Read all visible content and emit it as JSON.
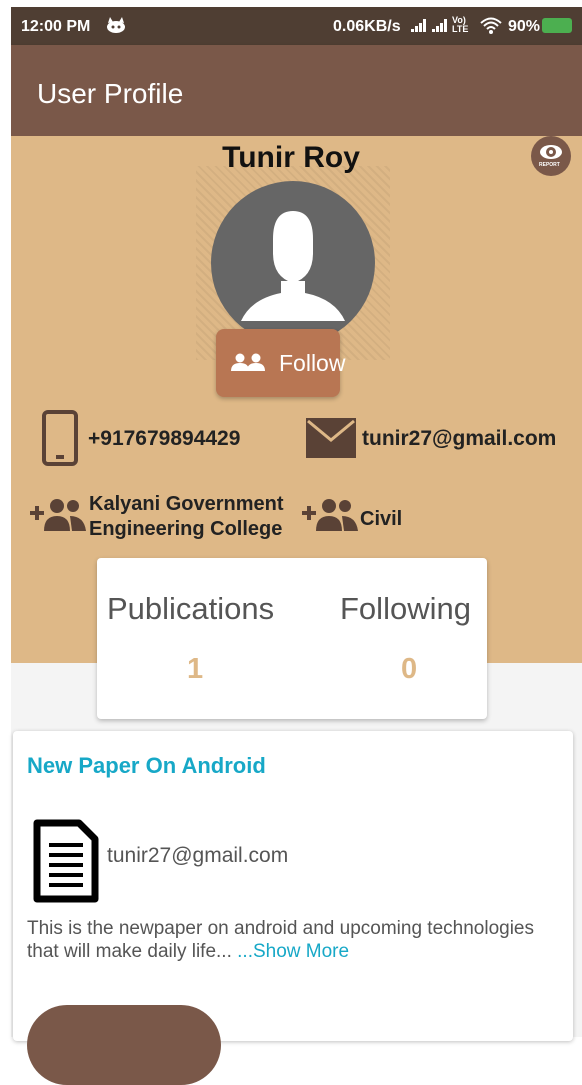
{
  "status_bar": {
    "time": "12:00 PM",
    "net_rate": "0.06KB/s",
    "lte_top": "Vo)",
    "lte_bottom": "LTE",
    "battery": "90%"
  },
  "app_bar": {
    "title": "User Profile"
  },
  "profile": {
    "name": "Tunir Roy",
    "report_label": "REPORT",
    "follow_label": "Follow",
    "phone": "+917679894429",
    "email": "tunir27@gmail.com",
    "college_line1": "Kalyani Government",
    "college_line2": "Engineering College",
    "department": "Civil"
  },
  "stats": {
    "publications_label": "Publications",
    "publications_value": "1",
    "following_label": "Following",
    "following_value": "0"
  },
  "paper": {
    "title": "New Paper On Android",
    "author_email": "tunir27@gmail.com",
    "description": "This is the newpaper on android and upcoming technologies that will make daily life...",
    "show_more": " ...Show More"
  },
  "colors": {
    "app_bar": "#7a5849",
    "status_bar": "#4f3e33",
    "header": "#deb887",
    "follow_button": "#b87653",
    "accent": "#17a8c7"
  },
  "icons": [
    "android-cat-icon",
    "signal-icon",
    "wifi-icon",
    "battery-charging-icon",
    "report-eye-icon",
    "person-silhouette-icon",
    "people-icon",
    "phone-icon",
    "mail-icon",
    "add-group-icon",
    "document-icon"
  ]
}
